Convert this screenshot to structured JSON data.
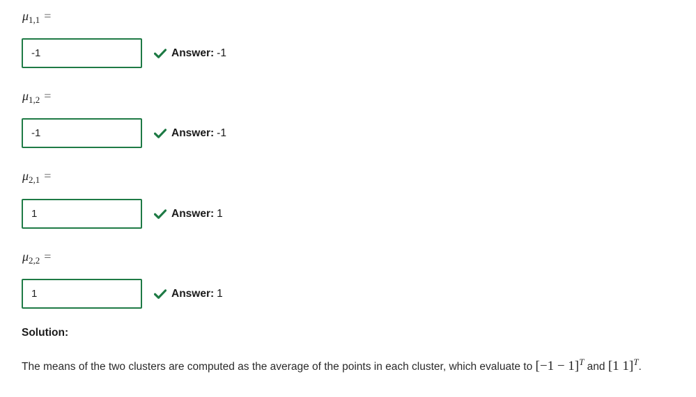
{
  "questions": [
    {
      "symbol": "μ",
      "subscript": "1,1",
      "equals": "=",
      "input_value": "-1",
      "answer_label": "Answer:",
      "answer_value": "-1"
    },
    {
      "symbol": "μ",
      "subscript": "1,2",
      "equals": "=",
      "input_value": "-1",
      "answer_label": "Answer:",
      "answer_value": "-1"
    },
    {
      "symbol": "μ",
      "subscript": "2,1",
      "equals": "=",
      "input_value": "1",
      "answer_label": "Answer:",
      "answer_value": "1"
    },
    {
      "symbol": "μ",
      "subscript": "2,2",
      "equals": "=",
      "input_value": "1",
      "answer_label": "Answer:",
      "answer_value": "1"
    }
  ],
  "solution": {
    "heading": "Solution:",
    "text_before": "The means of the two clusters are computed as the average of the points in each cluster, which evaluate to ",
    "vector_1": "[−1 − 1]",
    "transpose": "T",
    "text_and": " and ",
    "vector_2": "[1 1]",
    "text_end": "."
  },
  "colors": {
    "input_border": "#1e7a45",
    "check": "#1e7a45"
  },
  "icons": {
    "correct": "check-icon"
  }
}
